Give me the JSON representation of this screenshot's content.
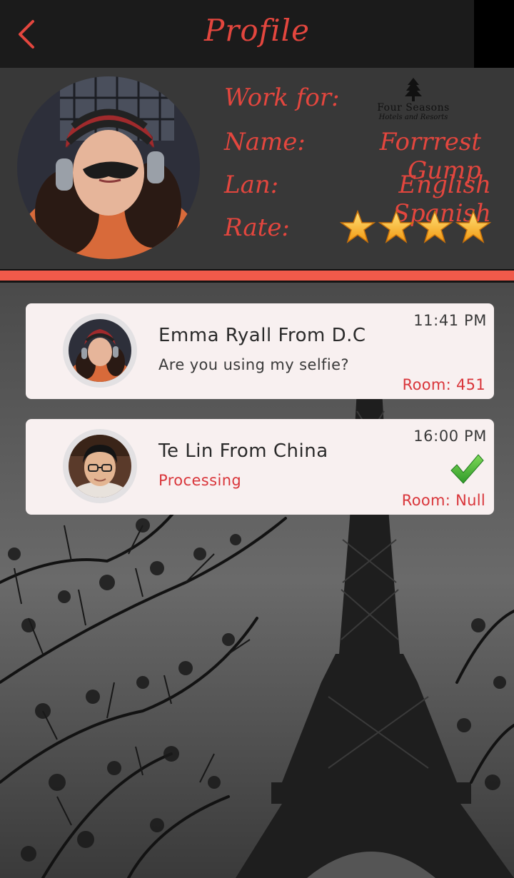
{
  "header": {
    "title": "Profile",
    "back_icon": "chevron-left-icon",
    "accent": "#e3463e"
  },
  "profile": {
    "work_label": "Work for:",
    "name_label": "Name:",
    "lan_label": "Lan:",
    "rate_label": "Rate:",
    "name_value": "Forrrest Gump",
    "lan_value": "English Spanish",
    "company_logo": {
      "name": "Four Seasons",
      "subtitle": "Hotels and Resorts",
      "icon": "tree-icon"
    },
    "rating": 4,
    "rating_max": 4
  },
  "messages": [
    {
      "name": "Emma Ryall From D.C",
      "text": "Are you using my selfie?",
      "time": "11:41 PM",
      "room": "Room: 451",
      "status_icon": ""
    },
    {
      "name": "Te Lin From China",
      "text": "Processing",
      "time": "16:00 PM",
      "room": "Room: Null",
      "status_icon": "checkmark-icon"
    }
  ],
  "colors": {
    "accent_red": "#f05a4a",
    "card_bg": "#f8f0f0",
    "panel_bg": "#383838"
  }
}
